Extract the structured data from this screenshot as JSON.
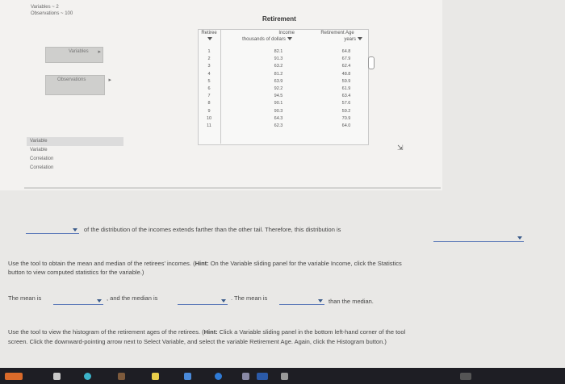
{
  "header_info": {
    "line1": "Variables ~ 2",
    "line2": "Observations ~ 100"
  },
  "side_panel": {
    "variables_btn": "Variables",
    "observations_btn": "Observations",
    "list": [
      "Variable",
      "Variable",
      "Correlation",
      "Correlation"
    ]
  },
  "table": {
    "title": "Retirement",
    "col_retiree": "Retiree",
    "col_income": "Income",
    "col_income_unit": "thousands of dollars",
    "col_age": "Retirement Age",
    "col_age_unit": "years",
    "retirees": [
      "1",
      "2",
      "3",
      "4",
      "5",
      "6",
      "7",
      "8",
      "9",
      "10",
      "11"
    ],
    "incomes": [
      "82.1",
      "91.3",
      "63.2",
      "81.2",
      "63.9",
      "92.2",
      "94.5",
      "90.1",
      "90.3",
      "64.3",
      "62.3"
    ],
    "ages": [
      "64.8",
      "67.9",
      "62.4",
      "48.8",
      "59.9",
      "61.9",
      "63.4",
      "57.6",
      "59.2",
      "70.9",
      "64.0"
    ]
  },
  "q1": {
    "sentence": "of the distribution of the incomes extends farther than the other tail. Therefore, this distribution is"
  },
  "q2": {
    "instr_a": "Use the tool to obtain the mean and median of the retirees' incomes. (",
    "hint": "Hint:",
    "instr_b": " On the Variable sliding panel for the variable Income, click the Statistics",
    "instr_line2": "button to view computed statistics for the variable.)",
    "mean_label": "The mean is",
    "median_label": ", and the median is",
    "mean_label2": ". The mean is",
    "than_median": "than the median."
  },
  "q3": {
    "instr_a": "Use the tool to view the histogram of the retirement ages of the retirees. (",
    "hint": "Hint:",
    "instr_b": " Click a Variable sliding panel in the bottom left-hand corner of the tool",
    "instr_line2": "screen. Click the downward-pointing arrow next to Select Variable, and select the variable Retirement Age. Again, click the Histogram button.)"
  },
  "colors": {
    "accent": "#3a5a8a",
    "taskbar": "#1e1e24"
  }
}
